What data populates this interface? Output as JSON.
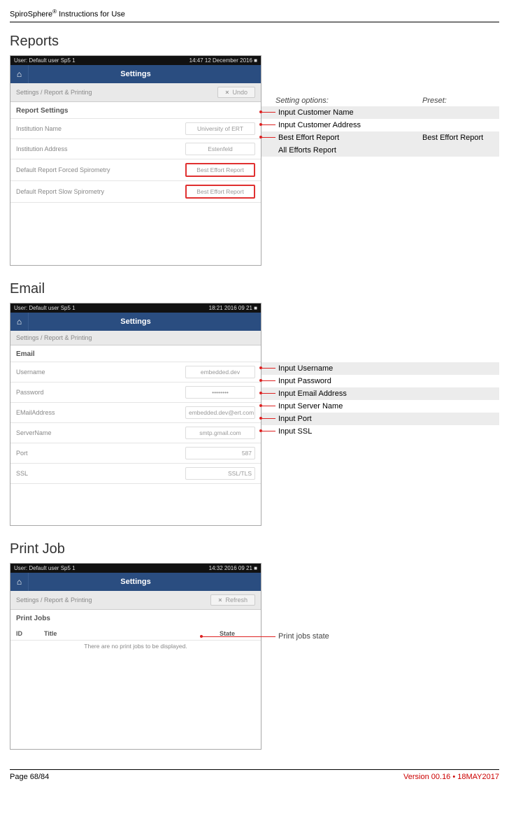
{
  "doc": {
    "header_pre": "SpiroSphere",
    "header_reg": "®",
    "header_post": " Instructions for Use",
    "page": "Page 68/84",
    "version": "Version 00.16 • 18MAY2017"
  },
  "sections": {
    "reports": "Reports",
    "email": "Email",
    "printjob": "Print Job"
  },
  "common": {
    "settings_title": "Settings",
    "home_icon": "⌂",
    "breadcrumb": "Settings / Report & Printing",
    "undo_label": "Undo",
    "refresh_label": "Refresh",
    "close_x": "×"
  },
  "reports_shot": {
    "status_left": "User: Default user Sp5 1",
    "status_right": "14:47 12 December 2016   ■",
    "panel": "Report Settings",
    "rows": [
      {
        "lbl": "Institution Name",
        "val": "University of ERT"
      },
      {
        "lbl": "Institution Address",
        "val": "Estenfeld"
      },
      {
        "lbl": "Default Report Forced Spirometry",
        "val": "Best Effort Report",
        "hl": true
      },
      {
        "lbl": "Default Report Slow Spirometry",
        "val": "Best Effort Report",
        "hl": true
      }
    ]
  },
  "reports_annot": {
    "h1": "Setting options:",
    "h2": "Preset:",
    "rows": [
      {
        "c1": "Input Customer Name",
        "c2": "",
        "shade": true
      },
      {
        "c1": "Input Customer Address",
        "c2": "",
        "shade": false
      },
      {
        "c1": "Best Effort Report",
        "c2": "Best Effort Report",
        "shade": true
      },
      {
        "c1": "All Efforts Report",
        "c2": "",
        "shade": true
      }
    ]
  },
  "email_shot": {
    "status_left": "User: Default user Sp5 1",
    "status_right": "18:21 2016 09 21   ■",
    "panel": "Email",
    "rows": [
      {
        "lbl": "Username",
        "val": "embedded.dev"
      },
      {
        "lbl": "Password",
        "val": "••••••••"
      },
      {
        "lbl": "EMailAddress",
        "val": "embedded.dev@ert.com"
      },
      {
        "lbl": "ServerName",
        "val": "smtp.gmail.com"
      },
      {
        "lbl": "Port",
        "val": "587"
      },
      {
        "lbl": "SSL",
        "val": "SSL/TLS"
      }
    ]
  },
  "email_annot": {
    "rows": [
      {
        "txt": "Input Username",
        "shade": true
      },
      {
        "txt": "Input Password",
        "shade": false
      },
      {
        "txt": "Input Email Address",
        "shade": true
      },
      {
        "txt": "Input Server Name",
        "shade": false
      },
      {
        "txt": "Input Port",
        "shade": true
      },
      {
        "txt": "Input SSL",
        "shade": false
      }
    ]
  },
  "pj_shot": {
    "status_left": "User: Default user Sp5 1",
    "status_right": "14:32 2016 09 21   ■",
    "panel": "Print Jobs",
    "cols": {
      "id": "ID",
      "title": "Title",
      "state": "State"
    },
    "msg": "There are no print jobs to be displayed."
  },
  "pj_annot": {
    "txt": "Print jobs state"
  }
}
